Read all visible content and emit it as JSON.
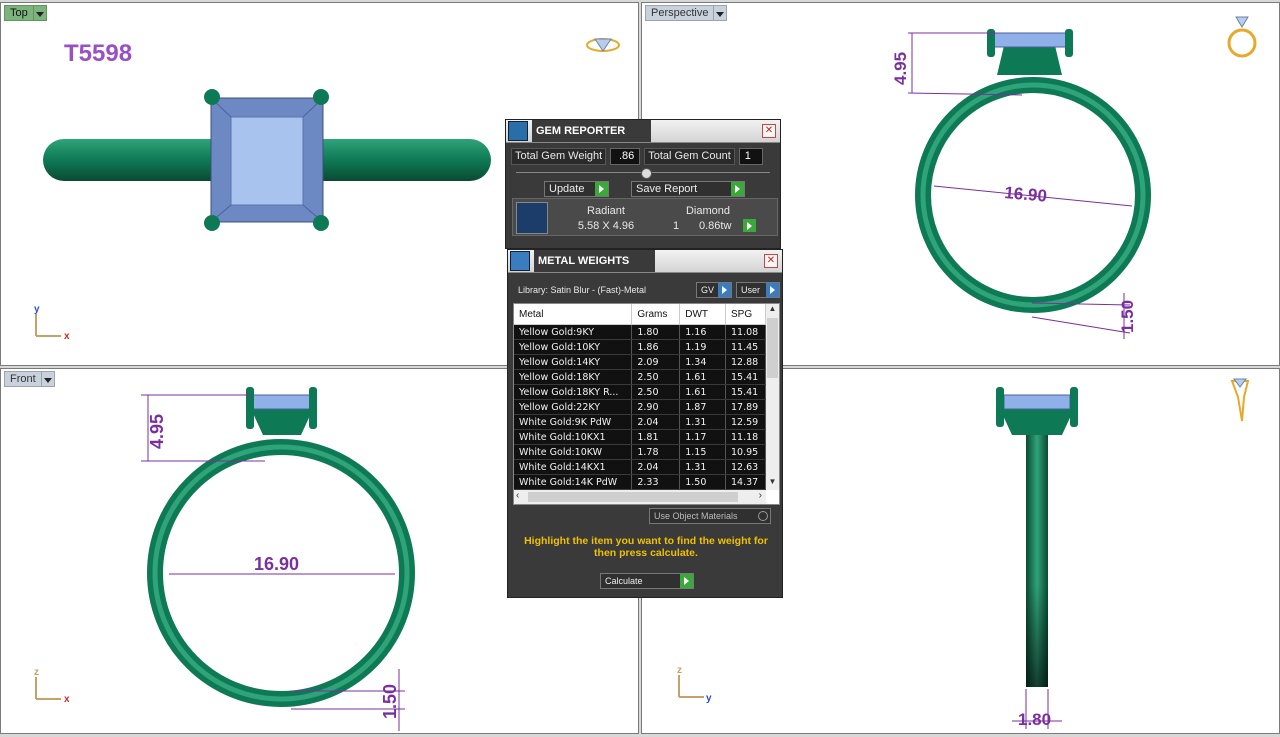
{
  "viewports": {
    "top": {
      "label": "Top",
      "model_id": "T5598",
      "axis_y": "y",
      "axis_x": "x"
    },
    "perspective": {
      "label": "Perspective",
      "dim_height": "4.95",
      "dim_width": "16.90",
      "dim_band": "1.50"
    },
    "front": {
      "label": "Front",
      "dim_height": "4.95",
      "dim_width": "16.90",
      "dim_band": "1.50",
      "axis_y": "z",
      "axis_x": "x"
    },
    "right": {
      "dim_band": "1.80",
      "axis_y": "z",
      "axis_x": "y"
    }
  },
  "gem_reporter": {
    "title": "GEM REPORTER",
    "total_weight_label": "Total Gem Weight",
    "total_weight_value": ".86",
    "total_count_label": "Total Gem Count",
    "total_count_value": "1",
    "update_label": "Update",
    "save_label": "Save Report",
    "gem": {
      "shape": "Radiant",
      "type": "Diamond",
      "size": "5.58 X 4.96",
      "count": "1",
      "weight": "0.86tw"
    }
  },
  "metal_weights": {
    "title": "METAL WEIGHTS",
    "library": "Library: Satin Blur - (Fast)-Metal",
    "gv_label": "GV",
    "user_label": "User",
    "columns": [
      "Metal",
      "Grams",
      "DWT",
      "SPG"
    ],
    "rows": [
      [
        "Yellow Gold:9KY",
        "1.80",
        "1.16",
        "11.08"
      ],
      [
        "Yellow Gold:10KY",
        "1.86",
        "1.19",
        "11.45"
      ],
      [
        "Yellow Gold:14KY",
        "2.09",
        "1.34",
        "12.88"
      ],
      [
        "Yellow Gold:18KY",
        "2.50",
        "1.61",
        "15.41"
      ],
      [
        "Yellow Gold:18KY R...",
        "2.50",
        "1.61",
        "15.41"
      ],
      [
        "Yellow Gold:22KY",
        "2.90",
        "1.87",
        "17.89"
      ],
      [
        "White Gold:9K PdW",
        "2.04",
        "1.31",
        "12.59"
      ],
      [
        "White Gold:10KX1",
        "1.81",
        "1.17",
        "11.18"
      ],
      [
        "White Gold:10KW",
        "1.78",
        "1.15",
        "10.95"
      ],
      [
        "White Gold:14KX1",
        "2.04",
        "1.31",
        "12.63"
      ],
      [
        "White Gold:14K PdW",
        "2.33",
        "1.50",
        "14.37"
      ]
    ],
    "use_object_materials": "Use Object Materials",
    "hint": "Highlight the item you want to find the weight for then press calculate.",
    "calculate_label": "Calculate"
  }
}
